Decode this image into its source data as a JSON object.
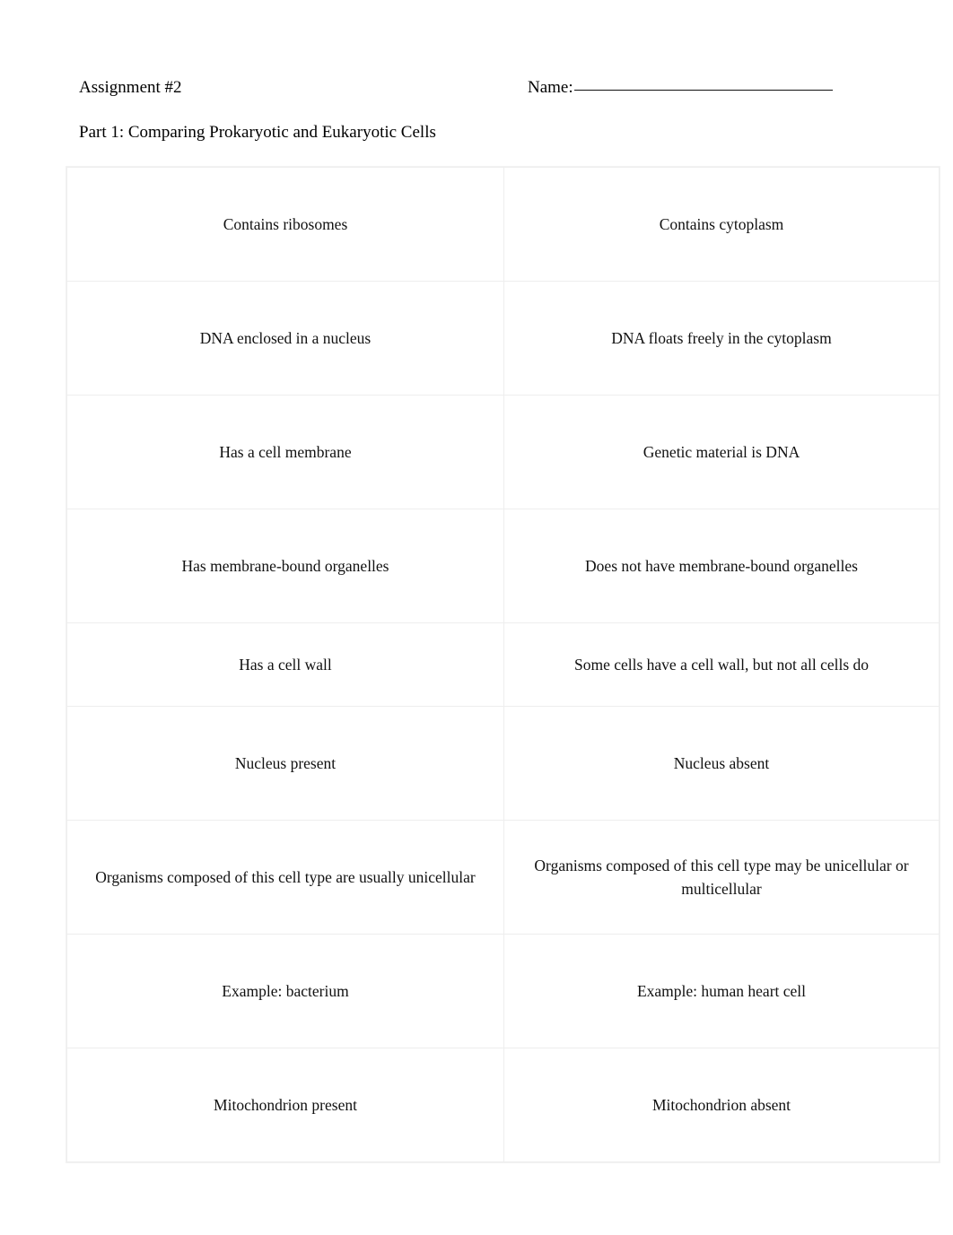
{
  "header": {
    "assignment": "Assignment #2",
    "name_label": "Name:",
    "name_value": ""
  },
  "part_heading": "Part 1: Comparing Prokaryotic and Eukaryotic Cells",
  "table": {
    "rows": [
      {
        "height": "tall",
        "left": "Contains ribosomes",
        "right": "Contains cytoplasm"
      },
      {
        "height": "tall",
        "left": "DNA enclosed in a nucleus",
        "right": "DNA floats freely in the cytoplasm"
      },
      {
        "height": "tall",
        "left": "Has a cell membrane",
        "right": "Genetic material is DNA"
      },
      {
        "height": "tall",
        "left": "Has membrane-bound organelles",
        "right": "Does not have membrane-bound organelles"
      },
      {
        "height": "short",
        "left": "Has a cell wall",
        "right": "Some cells have a cell wall, but not all cells do"
      },
      {
        "height": "tall",
        "left": "Nucleus present",
        "right": "Nucleus absent"
      },
      {
        "height": "tall",
        "left": "Organisms composed of this cell type are usually unicellular",
        "right": "Organisms composed of this cell type may be unicellular or multicellular"
      },
      {
        "height": "tall",
        "left": "Example: bacterium",
        "right": "Example: human heart cell"
      },
      {
        "height": "tall",
        "left": "Mitochondrion present",
        "right": "Mitochondrion absent"
      }
    ]
  },
  "colors": {
    "page_background": "#ffffff",
    "text": "#111111",
    "table_border": "#eeeeee",
    "rule": "#111111"
  }
}
